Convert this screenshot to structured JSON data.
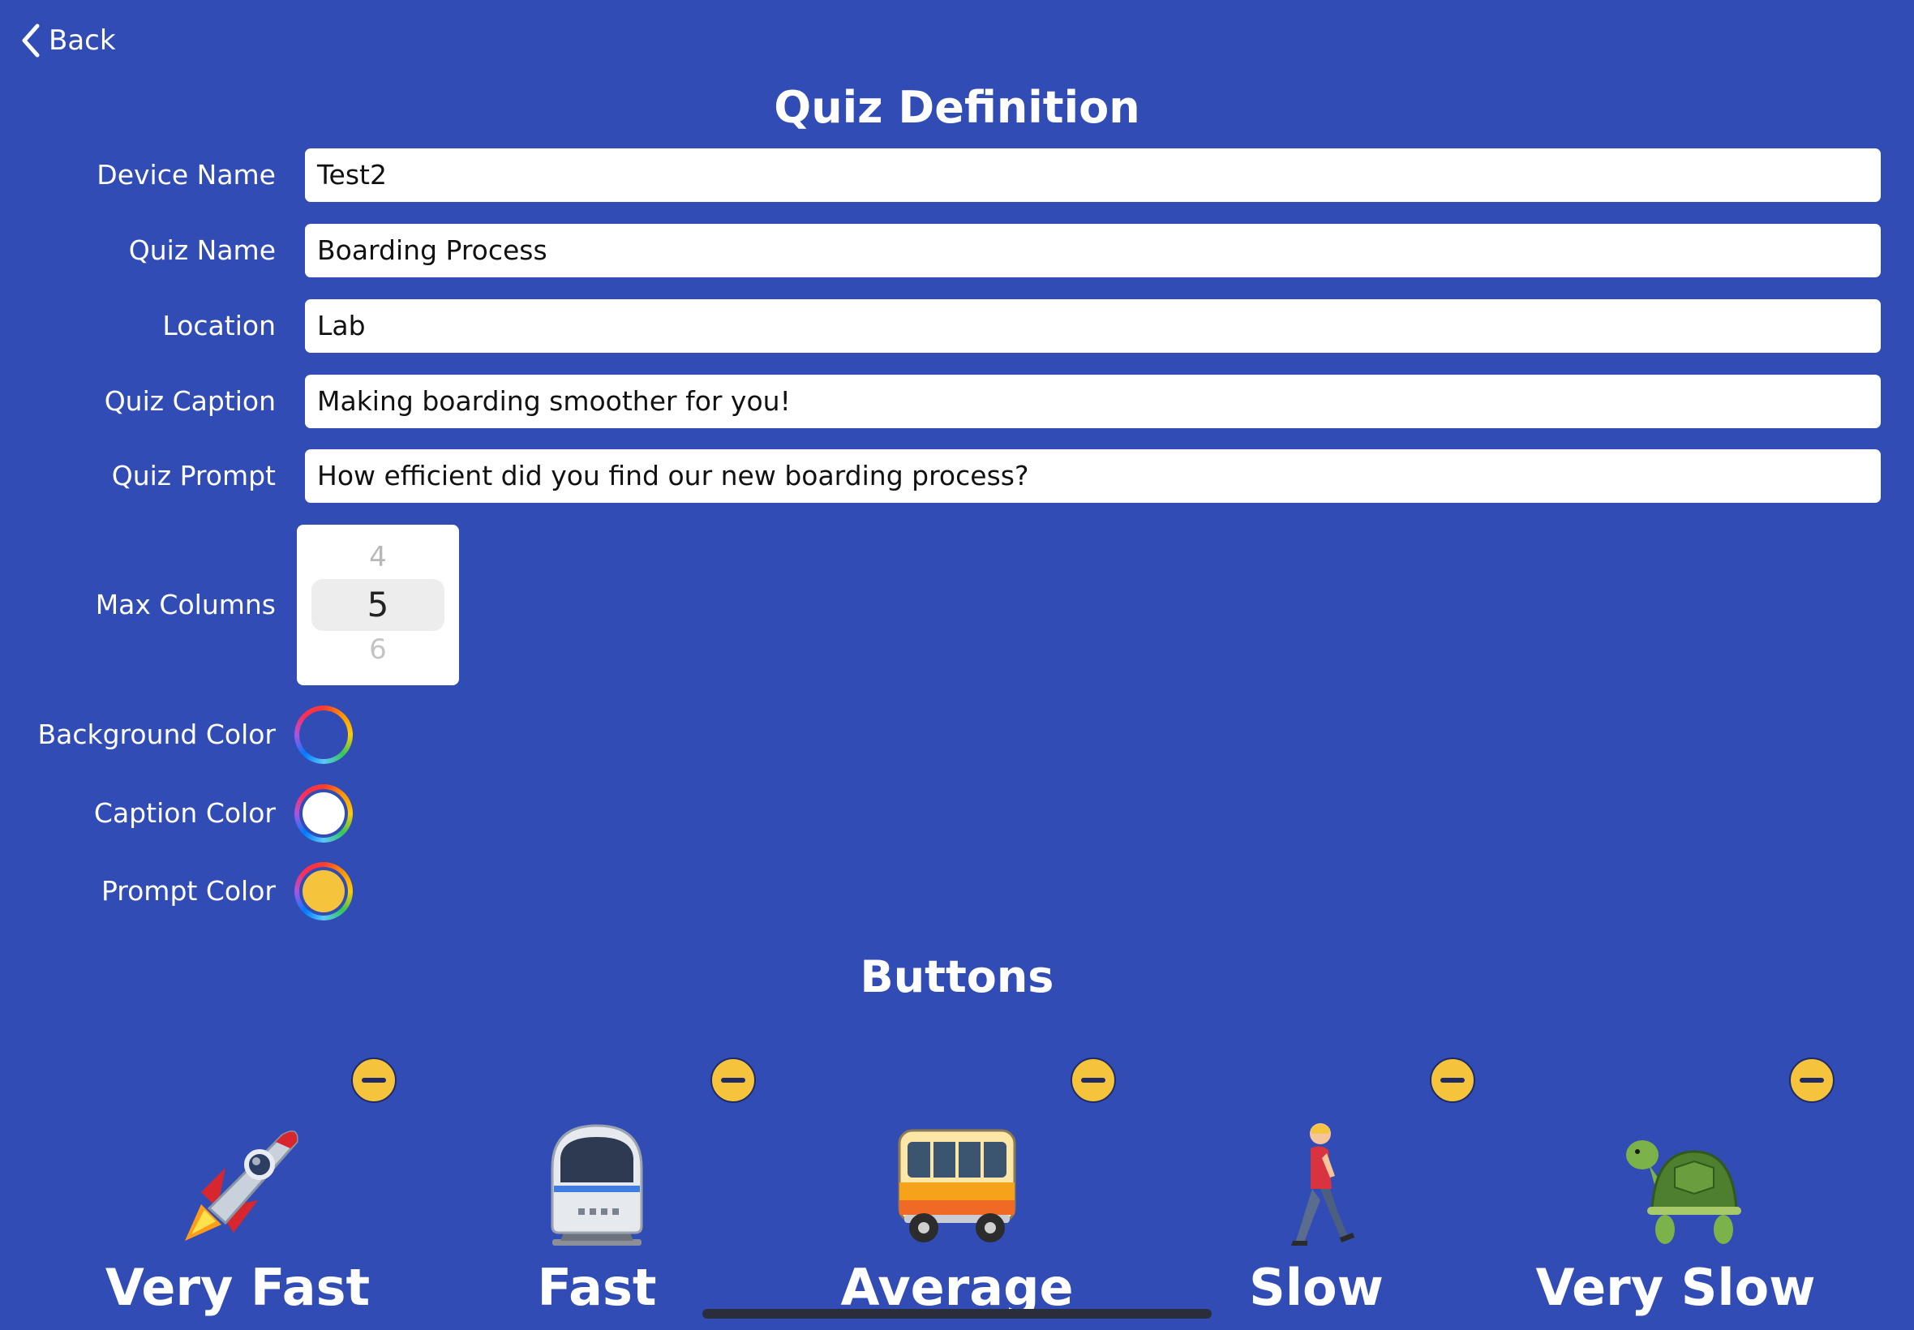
{
  "nav": {
    "back_label": "Back"
  },
  "page": {
    "title": "Quiz Definition"
  },
  "form": {
    "fields": [
      {
        "label": "Device Name",
        "value": "Test2"
      },
      {
        "label": "Quiz Name",
        "value": "Boarding Process"
      },
      {
        "label": "Location",
        "value": "Lab"
      },
      {
        "label": "Quiz Caption",
        "value": "Making boarding smoother for you!"
      },
      {
        "label": "Quiz Prompt",
        "value": "How efficient did you find our new boarding process?"
      }
    ],
    "max_columns": {
      "label": "Max Columns",
      "prev": "4",
      "value": "5",
      "next": "6"
    },
    "colors": [
      {
        "label": "Background Color",
        "value": "#314cb4"
      },
      {
        "label": "Caption Color",
        "value": "#ffffff"
      },
      {
        "label": "Prompt Color",
        "value": "#f6c33c"
      }
    ]
  },
  "buttons_section": {
    "title": "Buttons",
    "items": [
      {
        "label": "Very Fast",
        "icon": "rocket-icon"
      },
      {
        "label": "Fast",
        "icon": "train-icon"
      },
      {
        "label": "Average",
        "icon": "bus-icon"
      },
      {
        "label": "Slow",
        "icon": "walking-person-icon"
      },
      {
        "label": "Very Slow",
        "icon": "turtle-icon"
      }
    ]
  }
}
